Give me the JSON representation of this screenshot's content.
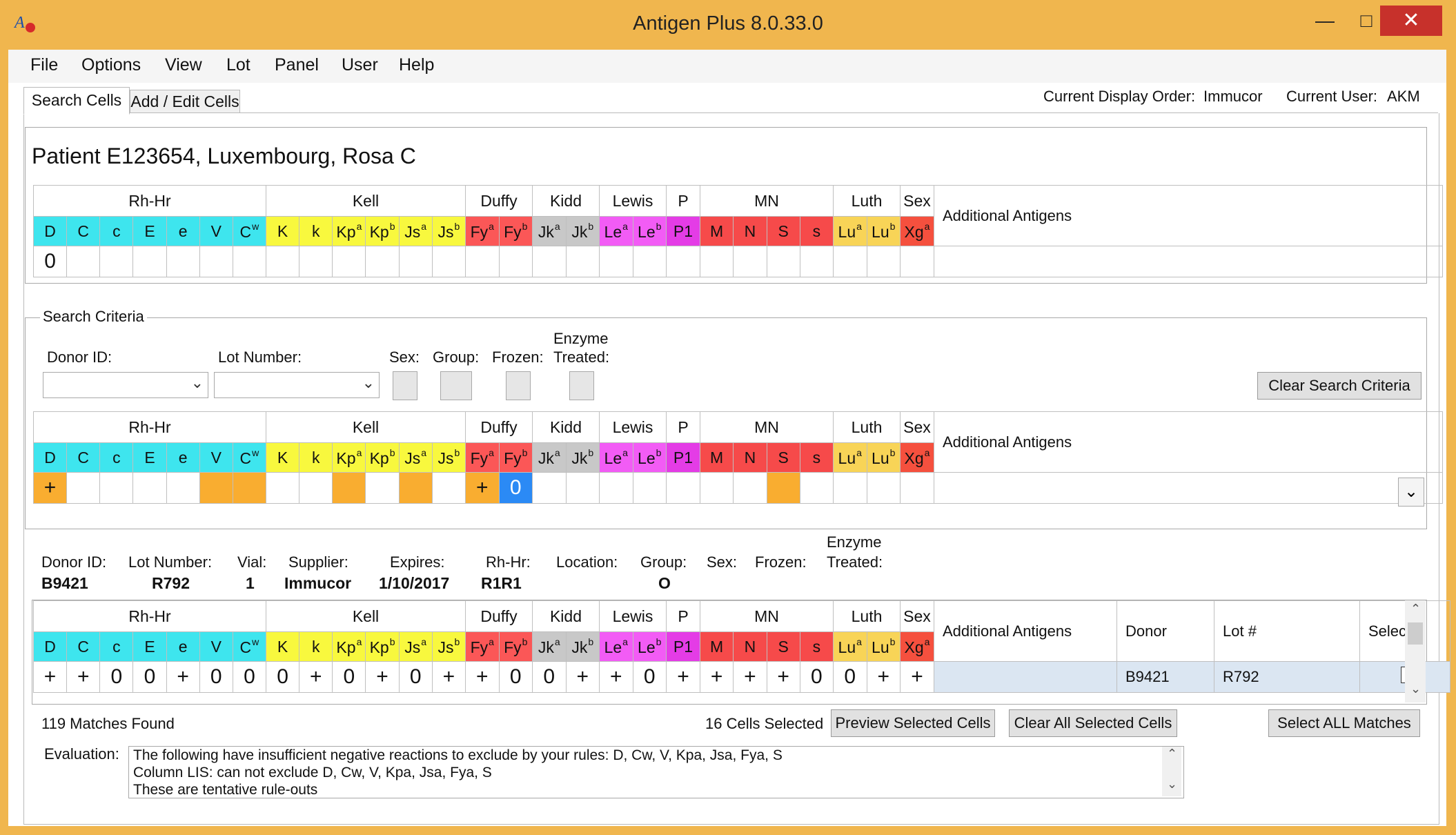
{
  "window": {
    "title": "Antigen Plus 8.0.33.0",
    "minimize": "—",
    "maximize": "□",
    "close": "✕"
  },
  "menu": [
    "File",
    "Options",
    "View",
    "Lot",
    "Panel",
    "User",
    "Help"
  ],
  "tabs": [
    "Search Cells",
    "Add / Edit Cells"
  ],
  "header_info": {
    "display_order_label": "Current Display Order:",
    "display_order_value": "Immucor",
    "user_label": "Current User:",
    "user_value": "AKM"
  },
  "patient": {
    "title": "Patient E123654, Luxembourg, Rosa C",
    "values": [
      "0",
      "",
      "",
      "",
      "",
      "",
      "",
      "",
      "",
      "",
      "",
      "",
      "",
      "",
      "",
      "",
      "",
      "",
      "",
      "",
      "",
      "",
      "",
      "",
      "",
      "",
      ""
    ]
  },
  "groups": [
    {
      "name": "Rh-Hr",
      "span": 7
    },
    {
      "name": "Kell",
      "span": 6
    },
    {
      "name": "Duffy",
      "span": 2
    },
    {
      "name": "Kidd",
      "span": 2
    },
    {
      "name": "Lewis",
      "span": 2
    },
    {
      "name": "P",
      "span": 1
    },
    {
      "name": "MN",
      "span": 4
    },
    {
      "name": "Luth",
      "span": 2
    },
    {
      "name": "Sex",
      "span": 1
    }
  ],
  "antigens": [
    {
      "base": "D",
      "sup": "",
      "color": "#3ee5ee"
    },
    {
      "base": "C",
      "sup": "",
      "color": "#3ee5ee"
    },
    {
      "base": "c",
      "sup": "",
      "color": "#3ee5ee"
    },
    {
      "base": "E",
      "sup": "",
      "color": "#3ee5ee"
    },
    {
      "base": "e",
      "sup": "",
      "color": "#3ee5ee"
    },
    {
      "base": "V",
      "sup": "",
      "color": "#3ee5ee"
    },
    {
      "base": "C",
      "sup": "w",
      "color": "#3ee5ee"
    },
    {
      "base": "K",
      "sup": "",
      "color": "#f8f83e"
    },
    {
      "base": "k",
      "sup": "",
      "color": "#f8f83e"
    },
    {
      "base": "Kp",
      "sup": "a",
      "color": "#f8f83e"
    },
    {
      "base": "Kp",
      "sup": "b",
      "color": "#f8f83e"
    },
    {
      "base": "Js",
      "sup": "a",
      "color": "#f8f83e"
    },
    {
      "base": "Js",
      "sup": "b",
      "color": "#f8f83e"
    },
    {
      "base": "Fy",
      "sup": "a",
      "color": "#fb5757"
    },
    {
      "base": "Fy",
      "sup": "b",
      "color": "#fb5757"
    },
    {
      "base": "Jk",
      "sup": "a",
      "color": "#c8c8c8"
    },
    {
      "base": "Jk",
      "sup": "b",
      "color": "#c8c8c8"
    },
    {
      "base": "Le",
      "sup": "a",
      "color": "#f25cf5"
    },
    {
      "base": "Le",
      "sup": "b",
      "color": "#f25cf5"
    },
    {
      "base": "P1",
      "sup": "",
      "color": "#e43ce6"
    },
    {
      "base": "M",
      "sup": "",
      "color": "#f64a4a"
    },
    {
      "base": "N",
      "sup": "",
      "color": "#f64a4a"
    },
    {
      "base": "S",
      "sup": "",
      "color": "#f64a4a"
    },
    {
      "base": "s",
      "sup": "",
      "color": "#f64a4a"
    },
    {
      "base": "Lu",
      "sup": "a",
      "color": "#f8d457"
    },
    {
      "base": "Lu",
      "sup": "b",
      "color": "#f8d457"
    },
    {
      "base": "Xg",
      "sup": "a",
      "color": "#f5503e"
    }
  ],
  "additional_antigens_label": "Additional Antigens",
  "search_criteria": {
    "legend": "Search Criteria",
    "donor_id_label": "Donor ID:",
    "donor_id_value": "",
    "lot_number_label": "Lot Number:",
    "lot_number_value": "",
    "sex_label": "Sex:",
    "group_label": "Group:",
    "frozen_label": "Frozen:",
    "enzyme_label_1": "Enzyme",
    "enzyme_label_2": "Treated:",
    "clear_button": "Clear Search Criteria",
    "values": [
      "+",
      "",
      "",
      "",
      "",
      "",
      "",
      "",
      "",
      "",
      "",
      "",
      "",
      "+",
      "0",
      "",
      "",
      "",
      "",
      "",
      "",
      "",
      "",
      "",
      "",
      "",
      ""
    ],
    "highlight": [
      "orange",
      "",
      "",
      "",
      "",
      "orange",
      "orange",
      "",
      "",
      "orange",
      "",
      "orange",
      "",
      "orange",
      "blue",
      "",
      "",
      "",
      "",
      "",
      "",
      "",
      "orange",
      "",
      "",
      "",
      ""
    ]
  },
  "donor_detail": {
    "donor_id_label": "Donor ID:",
    "donor_id_value": "B9421",
    "lot_number_label": "Lot Number:",
    "lot_number_value": "R792",
    "vial_label": "Vial:",
    "vial_value": "1",
    "supplier_label": "Supplier:",
    "supplier_value": "Immucor",
    "expires_label": "Expires:",
    "expires_value": "1/10/2017",
    "rhhr_label": "Rh-Hr:",
    "rhhr_value": "R1R1",
    "location_label": "Location:",
    "group_label": "Group:",
    "group_value": "O",
    "sex_label": "Sex:",
    "frozen_label": "Frozen:",
    "enzyme_label_1": "Enzyme",
    "enzyme_label_2": "Treated:"
  },
  "results": {
    "donor_header": "Donor",
    "lot_header": "Lot #",
    "select_header": "Select",
    "rows": [
      {
        "values": [
          "+",
          "+",
          "0",
          "0",
          "+",
          "0",
          "0",
          "0",
          "+",
          "0",
          "+",
          "0",
          "+",
          "+",
          "0",
          "0",
          "+",
          "+",
          "0",
          "+",
          "+",
          "+",
          "+",
          "0",
          "0",
          "+",
          "+"
        ],
        "donor": "B9421",
        "lot": "R792"
      }
    ]
  },
  "footer": {
    "matches": "119 Matches Found",
    "cells_selected": "16 Cells Selected",
    "preview_button": "Preview Selected Cells",
    "clear_selected_button": "Clear All Selected Cells",
    "select_all_button": "Select ALL Matches",
    "evaluation_label": "Evaluation:",
    "evaluation_lines": [
      "The following have insufficient negative reactions to exclude by your rules: D, Cw, V, Kpa, Jsa, Fya, S",
      "Column LIS: can not exclude D, Cw, V, Kpa, Jsa, Fya, S",
      "These are tentative rule-outs"
    ]
  }
}
